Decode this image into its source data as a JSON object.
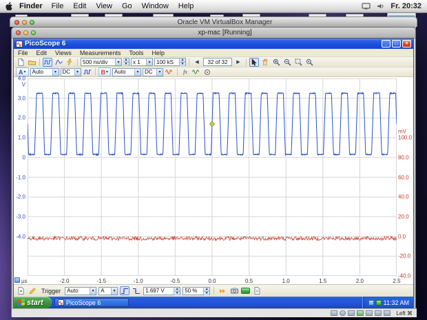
{
  "mac_menubar": {
    "app_name": "Finder",
    "menus": [
      "File",
      "Edit",
      "View",
      "Go",
      "Window",
      "Help"
    ],
    "clock": "Fr. 20:32"
  },
  "vbox": {
    "manager_title": "Oracle VM VirtualBox Manager",
    "vm_window_title": "xp-mac [Running]",
    "host_key_label": "Left ⌘"
  },
  "picoscope": {
    "window_title": "PicoScope 6",
    "menus": [
      "File",
      "Edit",
      "Views",
      "Measurements",
      "Tools",
      "Help"
    ],
    "toolbar": {
      "timebase_value": "500 ns/div",
      "zoom_value": "x 1",
      "samples_value": "100 kS",
      "buffer_position": "32 of 32"
    },
    "channel_a": {
      "label": "A",
      "range": "Auto",
      "coupling": "DC",
      "color": "#2a4fc8"
    },
    "channel_b": {
      "label": "B",
      "range": "Auto",
      "coupling": "DC",
      "color": "#cc4630"
    },
    "trigger_bar": {
      "label": "Trigger",
      "mode": "Auto",
      "source": "A",
      "threshold": "1.697 V",
      "pre_trigger": "50 %"
    }
  },
  "xp_taskbar": {
    "start_label": "start",
    "task_button": "PicoScope 6",
    "tray_time": "11:32 AM"
  },
  "icons": {
    "combo_arrow": "▾",
    "spin_up": "▲",
    "spin_down": "▼",
    "prev_buffer": "◀",
    "next_buffer": "▶",
    "window_close": "×",
    "window_minimize": "_",
    "window_maximize": "□",
    "math": "fx"
  },
  "chart_data": {
    "type": "line",
    "title": "PicoScope oscilloscope capture",
    "x_unit": "µs",
    "x_range_us": [
      -2.5,
      2.5
    ],
    "x_tick_labels": [
      "-2.0",
      "-1.5",
      "-1.0",
      "-0.5",
      "0.0",
      "0.5",
      "1.0",
      "1.5",
      "2.0",
      "2.5"
    ],
    "grid": {
      "columns": 10,
      "rows": 10
    },
    "left_axis": {
      "unit": "V",
      "color": "#2a46c4",
      "tick_labels": [
        "4.0",
        "3.0",
        "2.0",
        "1.0",
        "0",
        "-1.0",
        "-2.0",
        "-3.0",
        "-4.0"
      ],
      "top_tick_row": 0,
      "volts_per_division": 1.0
    },
    "right_axis": {
      "unit": "mV",
      "color": "#c23b28",
      "tick_labels": [
        "100.0",
        "80.0",
        "60.0",
        "40.0",
        "20.0",
        "0.0",
        "-20.0",
        "-40.0"
      ],
      "top_tick_row": 3,
      "mv_per_division": 20
    },
    "series": [
      {
        "name": "Channel A",
        "color": "#2a4fc8",
        "shape": "square_wave",
        "frequency_mhz": 4.6,
        "high_v": 3.25,
        "low_v": 0.15
      },
      {
        "name": "Channel B",
        "color": "#cc4630",
        "shape": "noise_line",
        "level_mv": -2,
        "noise_mv": 2
      }
    ],
    "trigger_marker": {
      "x_us": 0.0,
      "level_v": 1.697,
      "color": "#c9d44a"
    }
  }
}
